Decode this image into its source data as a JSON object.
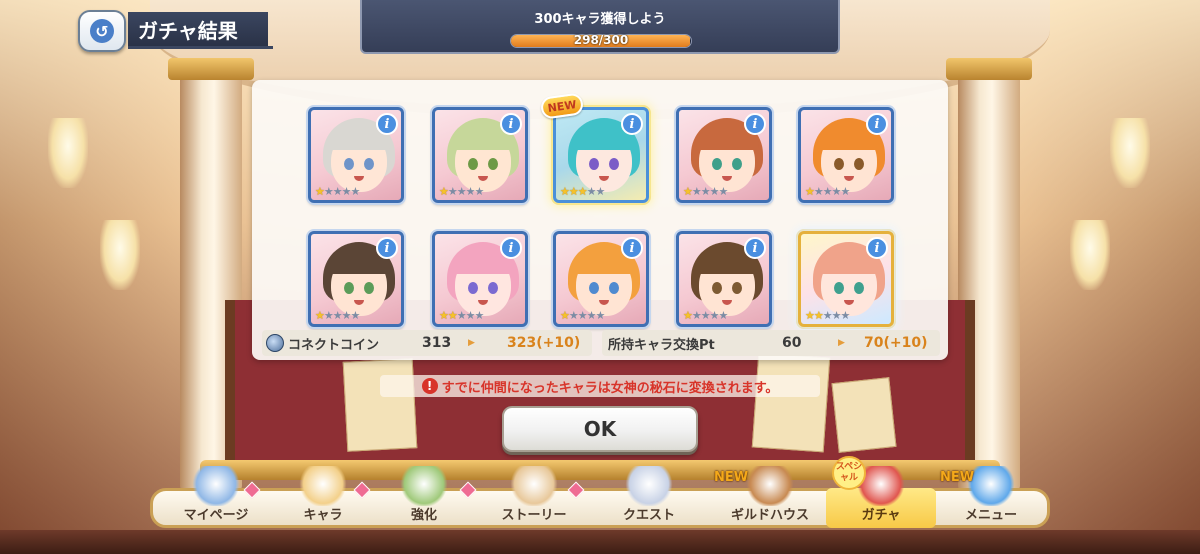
{
  "header": {
    "back_icon": "back-arrow-icon",
    "title": "ガチャ結果"
  },
  "mission": {
    "title": "300キャラ獲得しよう",
    "progress_text": "298/300",
    "progress_fraction": 0.993
  },
  "results": {
    "cards": [
      {
        "stars": 1,
        "hair": "#d9d7d2",
        "eyes": "#6f94c9",
        "skin": "#ffe6d6"
      },
      {
        "stars": 1,
        "hair": "#c6d79a",
        "eyes": "#6d9a46",
        "skin": "#ffe6d2"
      },
      {
        "stars": 3,
        "hair": "#3fc1c8",
        "eyes": "#7b5dc7",
        "skin": "#fde8df",
        "new": true,
        "rare": true
      },
      {
        "stars": 1,
        "hair": "#c8693e",
        "eyes": "#3f9f8a",
        "skin": "#ffe4d3"
      },
      {
        "stars": 1,
        "hair": "#f08b2e",
        "eyes": "#8a5a2a",
        "skin": "#ffe4d3"
      },
      {
        "stars": 1,
        "hair": "#5b4536",
        "eyes": "#5b9c59",
        "skin": "#ffe4d3"
      },
      {
        "stars": 2,
        "hair": "#f3a4bf",
        "eyes": "#7b6ad1",
        "skin": "#ffe6e0"
      },
      {
        "stars": 1,
        "hair": "#f3a03e",
        "eyes": "#4f8ad0",
        "skin": "#ffe4d3"
      },
      {
        "stars": 1,
        "hair": "#6b4a2e",
        "eyes": "#7d5a32",
        "skin": "#ffe4d3"
      },
      {
        "stars": 2,
        "hair": "#f0a38a",
        "eyes": "#3fa08e",
        "skin": "#ffe6dc",
        "holo": true
      }
    ],
    "info_label": "i",
    "new_label": "NEW",
    "star_glyph": "★"
  },
  "currency": {
    "coin_label": "コネクトコイン",
    "coin_icon": "connect-coin-icon",
    "coin_old": "313",
    "coin_new": "323(+10)",
    "pt_label": "所持キャラ交換Pt",
    "pt_old": "60",
    "pt_new": "70(+10)"
  },
  "notice": {
    "icon": "exclamation-icon",
    "text": "すでに仲間になったキャラは女神の秘石に変換されます。"
  },
  "ok_button": "OK",
  "nav": {
    "items": [
      {
        "label": "マイページ",
        "icon": "castle-icon"
      },
      {
        "label": "キャラ",
        "icon": "character-icon"
      },
      {
        "label": "強化",
        "icon": "upgrade-orbs-icon"
      },
      {
        "label": "ストーリー",
        "icon": "scroll-icon"
      },
      {
        "label": "クエスト",
        "icon": "sword-flag-icon"
      },
      {
        "label": "ギルドハウス",
        "icon": "guild-door-icon",
        "badge": "NEW"
      },
      {
        "label": "ガチャ",
        "icon": "gacha-icon",
        "active": true
      },
      {
        "label": "メニュー",
        "icon": "crystal-icon",
        "badge": "NEW"
      }
    ],
    "special_tag": "スペシャル"
  }
}
